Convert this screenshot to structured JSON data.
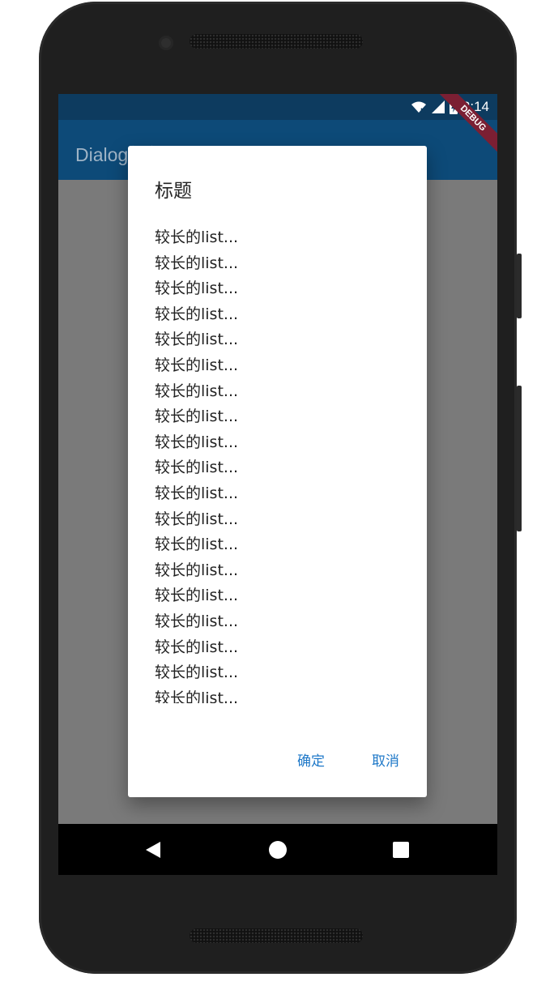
{
  "status_bar": {
    "time": "2:14",
    "icons": [
      "wifi-off-icon",
      "signal-icon",
      "battery-charging-icon"
    ]
  },
  "app_bar": {
    "title": "Dialog组件"
  },
  "debug_banner": "DEBUG",
  "dialog": {
    "title": "标题",
    "items": [
      "较长的list...",
      "较长的list...",
      "较长的list...",
      "较长的list...",
      "较长的list...",
      "较长的list...",
      "较长的list...",
      "较长的list...",
      "较长的list...",
      "较长的list...",
      "较长的list...",
      "较长的list...",
      "较长的list...",
      "较长的list...",
      "较长的list...",
      "较长的list...",
      "较长的list...",
      "较长的list...",
      "较长的list..."
    ],
    "actions": {
      "confirm": "确定",
      "cancel": "取消"
    }
  },
  "colors": {
    "status_bar": "#0d3b5f",
    "app_bar": "#0d4a78",
    "accent": "#1e78c8",
    "scrim": "#7a7a7a"
  },
  "nav_bar": {
    "icons": [
      "back-icon",
      "home-icon",
      "recents-icon"
    ]
  }
}
